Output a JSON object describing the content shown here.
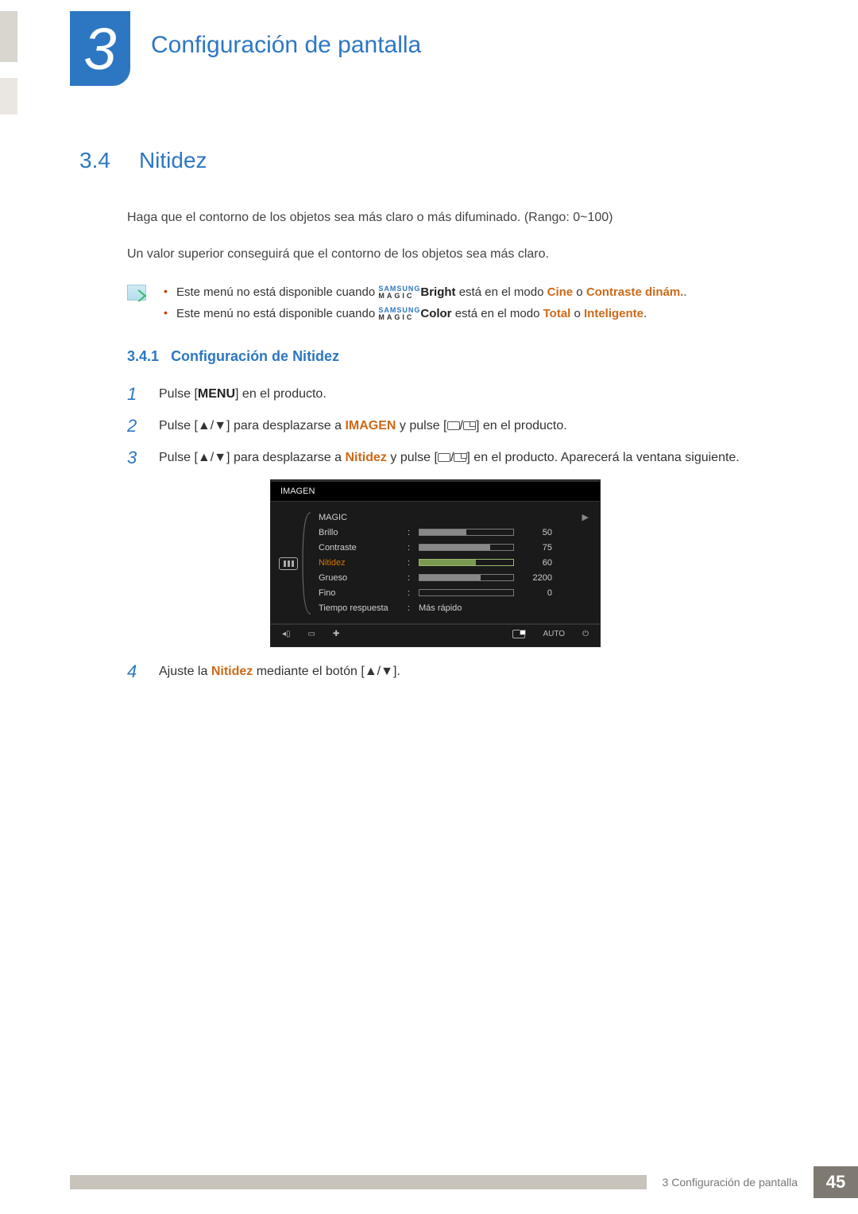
{
  "chapter": {
    "number": "3",
    "title": "Configuración de pantalla"
  },
  "section": {
    "number": "3.4",
    "title": "Nitidez"
  },
  "para1": "Haga que el contorno de los objetos sea más claro o más difuminado. (Rango: 0~100)",
  "para2": "Un valor superior conseguirá que el contorno de los objetos sea más claro.",
  "notes": {
    "magic_top": "SAMSUNG",
    "magic_bot": "MAGIC",
    "items": [
      {
        "pre": "Este menú no está disponible cuando ",
        "mid_bold": "Bright",
        "post1": " está en el modo ",
        "hl1": "Cine",
        "sep": " o ",
        "hl2": "Contraste dinám.",
        "end": "."
      },
      {
        "pre": "Este menú no está disponible cuando ",
        "mid_bold": "Color",
        "post1": " está en el modo ",
        "hl1": "Total",
        "sep": " o ",
        "hl2": "Inteligente",
        "end": "."
      }
    ]
  },
  "subsection": {
    "number": "3.4.1",
    "title": "Configuración de Nitidez"
  },
  "steps": [
    {
      "n": "1",
      "pre": "Pulse [",
      "bold": "MENU",
      "post": "] en el producto."
    },
    {
      "n": "2",
      "pre": "Pulse [",
      "ud": "▲/▼",
      "mid1": "] para desplazarse a ",
      "hl": "IMAGEN",
      "mid2": " y pulse [",
      "icons": true,
      "post": "] en el producto."
    },
    {
      "n": "3",
      "pre": "Pulse [",
      "ud": "▲/▼",
      "mid1": "] para desplazarse a ",
      "hl": "Nitidez",
      "mid2": " y pulse [",
      "icons": true,
      "post": "] en el producto. Aparecerá la ventana siguiente."
    },
    {
      "n": "4",
      "pre": "Ajuste la ",
      "hl": "Nitidez",
      "mid2": " mediante el botón [",
      "ud": "▲/▼",
      "post": "]."
    }
  ],
  "osd": {
    "title": "IMAGEN",
    "rows": [
      {
        "label": "MAGIC",
        "type": "nav"
      },
      {
        "label": "Brillo",
        "type": "bar",
        "fill": 50,
        "value": "50"
      },
      {
        "label": "Contraste",
        "type": "bar",
        "fill": 75,
        "value": "75"
      },
      {
        "label": "Nitidez",
        "type": "bar",
        "fill": 60,
        "value": "60",
        "active": true
      },
      {
        "label": "Grueso",
        "type": "bar",
        "fill": 65,
        "value": "2200"
      },
      {
        "label": "Fino",
        "type": "bar",
        "fill": 0,
        "value": "0"
      },
      {
        "label": "Tiempo respuesta",
        "type": "text",
        "text": "Más rápido"
      }
    ],
    "foot": {
      "auto": "AUTO"
    }
  },
  "footer": {
    "label": "3 Configuración de pantalla",
    "page": "45"
  }
}
